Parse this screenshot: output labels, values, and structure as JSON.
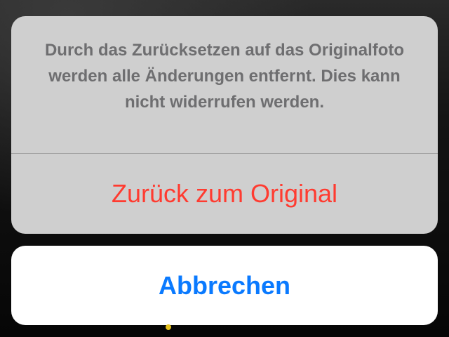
{
  "action_sheet": {
    "message": "Durch das Zurücksetzen auf das Originalfoto werden alle Änderungen entfernt. Dies kann nicht widerrufen werden.",
    "destructive_action_label": "Zurück zum Original"
  },
  "cancel": {
    "label": "Abbrechen"
  },
  "colors": {
    "destructive": "#ff3b30",
    "accent": "#0a7aff",
    "message_text": "#6e6e70",
    "sheet_background": "#cfcfcf",
    "indicator_dot": "#e6c21e"
  }
}
